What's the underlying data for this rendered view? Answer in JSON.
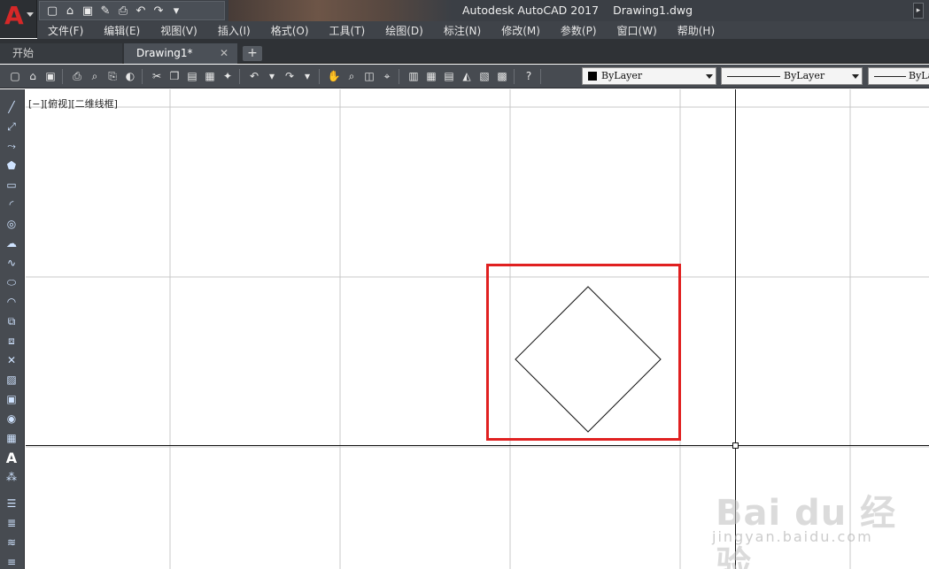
{
  "app": {
    "title": "Autodesk AutoCAD 2017",
    "document": "Drawing1.dwg",
    "logo_letter": "A",
    "accent_color": "#d62828"
  },
  "menu": [
    "文件(F)",
    "编辑(E)",
    "视图(V)",
    "插入(I)",
    "格式(O)",
    "工具(T)",
    "绘图(D)",
    "标注(N)",
    "修改(M)",
    "参数(P)",
    "窗口(W)",
    "帮助(H)"
  ],
  "tabs": {
    "start": "开始",
    "drawing": "Drawing1*",
    "close_glyph": "✕",
    "add_glyph": "+"
  },
  "toolbar": {
    "color_combo": "ByLayer",
    "linetype_combo": "ByLayer",
    "lineweight_combo": "ByLa"
  },
  "viewport": {
    "label": "[−][俯视][二维线框]"
  },
  "drawing": {
    "highlight_color": "#e02020",
    "shape": "diamond"
  },
  "watermark": {
    "brand": "Bai du 经验",
    "url": "jingyan.baidu.com"
  },
  "icons": {
    "qat": [
      "new-icon",
      "open-icon",
      "save-icon",
      "saveas-icon",
      "print-icon",
      "undo-icon",
      "redo-icon",
      "customize-icon"
    ],
    "left": [
      "line-icon",
      "construction-line-icon",
      "polyline-icon",
      "polygon-icon",
      "rectangle-icon",
      "arc-icon",
      "circle-icon",
      "revision-cloud-icon",
      "spline-icon",
      "ellipse-icon",
      "ellipse-arc-icon",
      "insert-block-icon",
      "make-block-icon",
      "point-icon",
      "hatch-icon",
      "gradient-icon",
      "region-icon",
      "table-icon",
      "multiline-text-icon",
      "add-selected-icon"
    ]
  }
}
